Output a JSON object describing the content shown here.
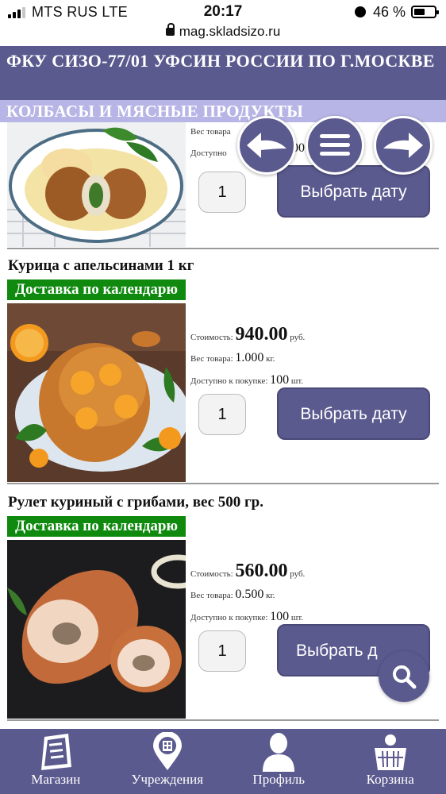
{
  "status_bar": {
    "carrier": "MTS RUS  LTE",
    "time": "20:17",
    "battery": "46 %",
    "battery_level": 0.46,
    "signal_bars": 3
  },
  "browser": {
    "url": "mag.skladsizo.ru"
  },
  "header": {
    "title": "ФКУ СИЗО-77/01 УФСИН РОССИИ ПО Г.МОСКВЕ",
    "category": "КОЛБАСЫ И МЯСНЫЕ ПРОДУКТЫ"
  },
  "labels": {
    "price": "Стоимость:",
    "currency": "руб.",
    "weight": "Вес товара:",
    "weight_unit": "кг.",
    "available": "Доступно к покупке:",
    "available_unit": "шт.",
    "delivery": "Доставка по календарю",
    "date_button": "Выбрать дату",
    "partial_weight": "Вес товара",
    "partial_available": "Доступно",
    "partial_available_value": "00"
  },
  "products": [
    {
      "quantity": "1",
      "photo_alt": "chicken cutlet with mashed potatoes"
    },
    {
      "name": "Курица с апельсинами 1 кг",
      "price": "940.00",
      "weight": "1.000",
      "available": "100",
      "quantity": "1"
    },
    {
      "name": "Рулет куриный с грибами, вес 500 гр.",
      "price": "560.00",
      "weight": "0.500",
      "available": "100",
      "quantity": "1",
      "date_button_partial": "Выбрать д"
    }
  ],
  "bottom_nav": [
    {
      "label": "Магазин",
      "icon": "shop-list-icon"
    },
    {
      "label": "Учреждения",
      "icon": "location-pin-icon"
    },
    {
      "label": "Профиль",
      "icon": "user-icon"
    },
    {
      "label": "Корзина",
      "icon": "basket-icon"
    }
  ],
  "colors": {
    "primary": "#5b5a8f",
    "category_bar": "#b7b5e6",
    "delivery_badge": "#0f8a0f"
  }
}
